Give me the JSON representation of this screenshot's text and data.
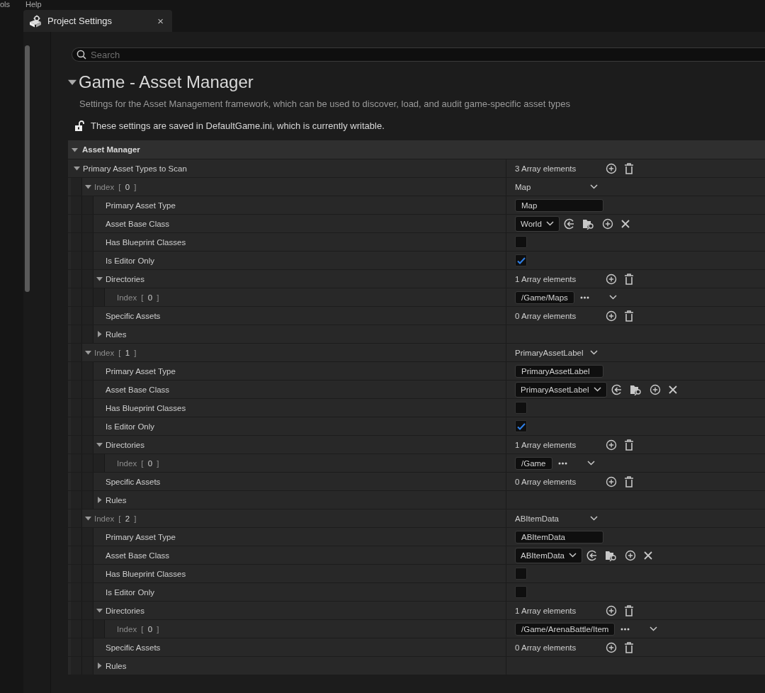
{
  "menu": [
    "ols",
    "Help"
  ],
  "tab": {
    "title": "Project Settings",
    "close": "×"
  },
  "search": {
    "placeholder": "Search"
  },
  "section": {
    "title": "Game - Asset Manager",
    "expanded": true,
    "description": "Settings for the Asset Management framework, which can be used to discover, load, and audit game-specific asset types",
    "notice": "These settings are saved in DefaultGame.ini, which is currently writable."
  },
  "category": {
    "title": "Asset Manager",
    "expanded": true
  },
  "property": {
    "kind": "array",
    "label": "Primary Asset Types to Scan",
    "expanded": true,
    "value": "3 Array elements",
    "children": [
      {
        "kind": "combo",
        "label": "Index [ **0** ]",
        "expanded": true,
        "value": "Map",
        "children": [
          {
            "kind": "text",
            "label": "Primary Asset Type",
            "value": "Map"
          },
          {
            "kind": "class",
            "label": "Asset Base Class",
            "value": "World"
          },
          {
            "kind": "checkbox",
            "label": "Has Blueprint Classes",
            "checked": false
          },
          {
            "kind": "checkbox",
            "label": "Is Editor Only",
            "checked": true
          },
          {
            "kind": "array",
            "label": "Directories",
            "expanded": true,
            "value": "1 Array elements",
            "children": [
              {
                "kind": "path",
                "label": "Index [ **0** ]",
                "value": "/Game/Maps"
              }
            ]
          },
          {
            "kind": "array",
            "label": "Specific Assets",
            "value": "0 Array elements"
          },
          {
            "kind": "group",
            "label": "Rules",
            "expanded": false
          }
        ]
      },
      {
        "kind": "combo",
        "label": "Index [ **1** ]",
        "expanded": true,
        "value": "PrimaryAssetLabel",
        "children": [
          {
            "kind": "text",
            "label": "Primary Asset Type",
            "value": "PrimaryAssetLabel"
          },
          {
            "kind": "class",
            "label": "Asset Base Class",
            "value": "PrimaryAssetLabel"
          },
          {
            "kind": "checkbox",
            "label": "Has Blueprint Classes",
            "checked": false
          },
          {
            "kind": "checkbox",
            "label": "Is Editor Only",
            "checked": true
          },
          {
            "kind": "array",
            "label": "Directories",
            "expanded": true,
            "value": "1 Array elements",
            "children": [
              {
                "kind": "path",
                "label": "Index [ **0** ]",
                "value": "/Game"
              }
            ]
          },
          {
            "kind": "array",
            "label": "Specific Assets",
            "value": "0 Array elements"
          },
          {
            "kind": "group",
            "label": "Rules",
            "expanded": false
          }
        ]
      },
      {
        "kind": "combo",
        "label": "Index [ **2** ]",
        "expanded": true,
        "value": "ABItemData",
        "children": [
          {
            "kind": "text",
            "label": "Primary Asset Type",
            "value": "ABItemData"
          },
          {
            "kind": "class",
            "label": "Asset Base Class",
            "value": "ABItemData"
          },
          {
            "kind": "checkbox",
            "label": "Has Blueprint Classes",
            "checked": false
          },
          {
            "kind": "checkbox",
            "label": "Is Editor Only",
            "checked": false
          },
          {
            "kind": "array",
            "label": "Directories",
            "expanded": true,
            "value": "1 Array elements",
            "children": [
              {
                "kind": "path",
                "label": "Index [ **0** ]",
                "value": "/Game/ArenaBattle/Item"
              }
            ]
          },
          {
            "kind": "array",
            "label": "Specific Assets",
            "value": "0 Array elements"
          },
          {
            "kind": "group",
            "label": "Rules",
            "expanded": false
          }
        ]
      }
    ]
  }
}
